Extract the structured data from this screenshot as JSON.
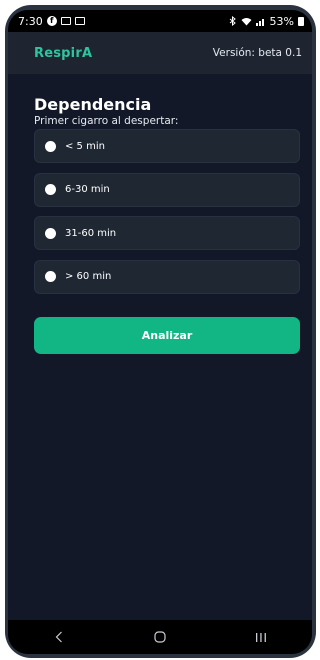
{
  "status_bar": {
    "time": "7:30",
    "battery_percent": "53%",
    "icons": [
      "facebook-icon",
      "mail-icon",
      "gallery-icon",
      "bluetooth-icon",
      "wifi-icon",
      "signal-icon",
      "battery-icon"
    ]
  },
  "header": {
    "brand": "RespirA",
    "version": "Versión: beta 0.1"
  },
  "section": {
    "title": "Dependencia",
    "question": "Primer cigarro al despertar:"
  },
  "options": [
    {
      "label": "< 5 min"
    },
    {
      "label": "6-30 min"
    },
    {
      "label": "31-60 min"
    },
    {
      "label": "> 60 min"
    }
  ],
  "actions": {
    "analyze_label": "Analizar"
  },
  "colors": {
    "brand": "#2ec4a0",
    "background": "#121828",
    "card": "#1f2733",
    "button": "#12b584"
  }
}
